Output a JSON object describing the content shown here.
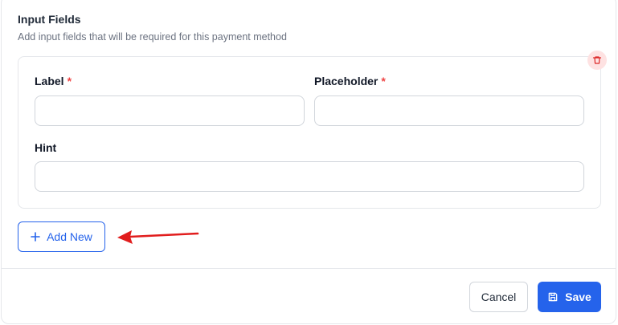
{
  "section": {
    "title": "Input Fields",
    "description": "Add input fields that will be required for this payment method"
  },
  "field_card": {
    "label_field": {
      "label": "Label",
      "required_mark": "*",
      "value": "",
      "placeholder": ""
    },
    "placeholder_field": {
      "label": "Placeholder",
      "required_mark": "*",
      "value": "",
      "placeholder": ""
    },
    "hint_field": {
      "label": "Hint",
      "value": "",
      "placeholder": ""
    },
    "delete_icon": "trash-icon"
  },
  "add_new": {
    "icon": "plus-icon",
    "label": "Add New"
  },
  "annotation": {
    "icon": "red-arrow-left"
  },
  "footer": {
    "cancel_label": "Cancel",
    "save_label": "Save",
    "save_icon": "floppy-disk-icon"
  },
  "colors": {
    "primary": "#2563eb",
    "danger": "#ef4444",
    "danger_bg": "#fee2e2",
    "border": "#e5e7eb",
    "annotation_arrow": "#e11d1d"
  }
}
